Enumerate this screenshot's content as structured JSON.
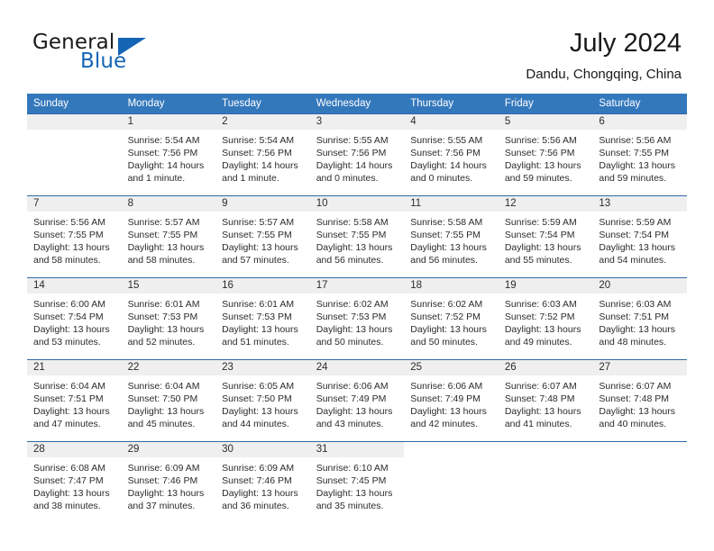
{
  "brand": {
    "name_part1": "General",
    "name_part2": "Blue",
    "flag_icon": "triangle-flag-icon",
    "accent_color": "#1565b5"
  },
  "header": {
    "title": "July 2024",
    "location": "Dandu, Chongqing, China"
  },
  "calendar": {
    "header_bg": "#3478bc",
    "header_text_color": "#ffffff",
    "daynum_bg": "#efefef",
    "row_border_color": "#2f6aa8",
    "weekday_headers": [
      "Sunday",
      "Monday",
      "Tuesday",
      "Wednesday",
      "Thursday",
      "Friday",
      "Saturday"
    ],
    "weeks": [
      [
        {
          "day": "",
          "empty": true,
          "lines": []
        },
        {
          "day": "1",
          "lines": [
            "Sunrise: 5:54 AM",
            "Sunset: 7:56 PM",
            "Daylight: 14 hours",
            "and 1 minute."
          ]
        },
        {
          "day": "2",
          "lines": [
            "Sunrise: 5:54 AM",
            "Sunset: 7:56 PM",
            "Daylight: 14 hours",
            "and 1 minute."
          ]
        },
        {
          "day": "3",
          "lines": [
            "Sunrise: 5:55 AM",
            "Sunset: 7:56 PM",
            "Daylight: 14 hours",
            "and 0 minutes."
          ]
        },
        {
          "day": "4",
          "lines": [
            "Sunrise: 5:55 AM",
            "Sunset: 7:56 PM",
            "Daylight: 14 hours",
            "and 0 minutes."
          ]
        },
        {
          "day": "5",
          "lines": [
            "Sunrise: 5:56 AM",
            "Sunset: 7:56 PM",
            "Daylight: 13 hours",
            "and 59 minutes."
          ]
        },
        {
          "day": "6",
          "lines": [
            "Sunrise: 5:56 AM",
            "Sunset: 7:55 PM",
            "Daylight: 13 hours",
            "and 59 minutes."
          ]
        }
      ],
      [
        {
          "day": "7",
          "lines": [
            "Sunrise: 5:56 AM",
            "Sunset: 7:55 PM",
            "Daylight: 13 hours",
            "and 58 minutes."
          ]
        },
        {
          "day": "8",
          "lines": [
            "Sunrise: 5:57 AM",
            "Sunset: 7:55 PM",
            "Daylight: 13 hours",
            "and 58 minutes."
          ]
        },
        {
          "day": "9",
          "lines": [
            "Sunrise: 5:57 AM",
            "Sunset: 7:55 PM",
            "Daylight: 13 hours",
            "and 57 minutes."
          ]
        },
        {
          "day": "10",
          "lines": [
            "Sunrise: 5:58 AM",
            "Sunset: 7:55 PM",
            "Daylight: 13 hours",
            "and 56 minutes."
          ]
        },
        {
          "day": "11",
          "lines": [
            "Sunrise: 5:58 AM",
            "Sunset: 7:55 PM",
            "Daylight: 13 hours",
            "and 56 minutes."
          ]
        },
        {
          "day": "12",
          "lines": [
            "Sunrise: 5:59 AM",
            "Sunset: 7:54 PM",
            "Daylight: 13 hours",
            "and 55 minutes."
          ]
        },
        {
          "day": "13",
          "lines": [
            "Sunrise: 5:59 AM",
            "Sunset: 7:54 PM",
            "Daylight: 13 hours",
            "and 54 minutes."
          ]
        }
      ],
      [
        {
          "day": "14",
          "lines": [
            "Sunrise: 6:00 AM",
            "Sunset: 7:54 PM",
            "Daylight: 13 hours",
            "and 53 minutes."
          ]
        },
        {
          "day": "15",
          "lines": [
            "Sunrise: 6:01 AM",
            "Sunset: 7:53 PM",
            "Daylight: 13 hours",
            "and 52 minutes."
          ]
        },
        {
          "day": "16",
          "lines": [
            "Sunrise: 6:01 AM",
            "Sunset: 7:53 PM",
            "Daylight: 13 hours",
            "and 51 minutes."
          ]
        },
        {
          "day": "17",
          "lines": [
            "Sunrise: 6:02 AM",
            "Sunset: 7:53 PM",
            "Daylight: 13 hours",
            "and 50 minutes."
          ]
        },
        {
          "day": "18",
          "lines": [
            "Sunrise: 6:02 AM",
            "Sunset: 7:52 PM",
            "Daylight: 13 hours",
            "and 50 minutes."
          ]
        },
        {
          "day": "19",
          "lines": [
            "Sunrise: 6:03 AM",
            "Sunset: 7:52 PM",
            "Daylight: 13 hours",
            "and 49 minutes."
          ]
        },
        {
          "day": "20",
          "lines": [
            "Sunrise: 6:03 AM",
            "Sunset: 7:51 PM",
            "Daylight: 13 hours",
            "and 48 minutes."
          ]
        }
      ],
      [
        {
          "day": "21",
          "lines": [
            "Sunrise: 6:04 AM",
            "Sunset: 7:51 PM",
            "Daylight: 13 hours",
            "and 47 minutes."
          ]
        },
        {
          "day": "22",
          "lines": [
            "Sunrise: 6:04 AM",
            "Sunset: 7:50 PM",
            "Daylight: 13 hours",
            "and 45 minutes."
          ]
        },
        {
          "day": "23",
          "lines": [
            "Sunrise: 6:05 AM",
            "Sunset: 7:50 PM",
            "Daylight: 13 hours",
            "and 44 minutes."
          ]
        },
        {
          "day": "24",
          "lines": [
            "Sunrise: 6:06 AM",
            "Sunset: 7:49 PM",
            "Daylight: 13 hours",
            "and 43 minutes."
          ]
        },
        {
          "day": "25",
          "lines": [
            "Sunrise: 6:06 AM",
            "Sunset: 7:49 PM",
            "Daylight: 13 hours",
            "and 42 minutes."
          ]
        },
        {
          "day": "26",
          "lines": [
            "Sunrise: 6:07 AM",
            "Sunset: 7:48 PM",
            "Daylight: 13 hours",
            "and 41 minutes."
          ]
        },
        {
          "day": "27",
          "lines": [
            "Sunrise: 6:07 AM",
            "Sunset: 7:48 PM",
            "Daylight: 13 hours",
            "and 40 minutes."
          ]
        }
      ],
      [
        {
          "day": "28",
          "lines": [
            "Sunrise: 6:08 AM",
            "Sunset: 7:47 PM",
            "Daylight: 13 hours",
            "and 38 minutes."
          ]
        },
        {
          "day": "29",
          "lines": [
            "Sunrise: 6:09 AM",
            "Sunset: 7:46 PM",
            "Daylight: 13 hours",
            "and 37 minutes."
          ]
        },
        {
          "day": "30",
          "lines": [
            "Sunrise: 6:09 AM",
            "Sunset: 7:46 PM",
            "Daylight: 13 hours",
            "and 36 minutes."
          ]
        },
        {
          "day": "31",
          "lines": [
            "Sunrise: 6:10 AM",
            "Sunset: 7:45 PM",
            "Daylight: 13 hours",
            "and 35 minutes."
          ]
        },
        {
          "day": "",
          "blank": true,
          "lines": []
        },
        {
          "day": "",
          "blank": true,
          "lines": []
        },
        {
          "day": "",
          "blank": true,
          "lines": []
        }
      ]
    ]
  }
}
